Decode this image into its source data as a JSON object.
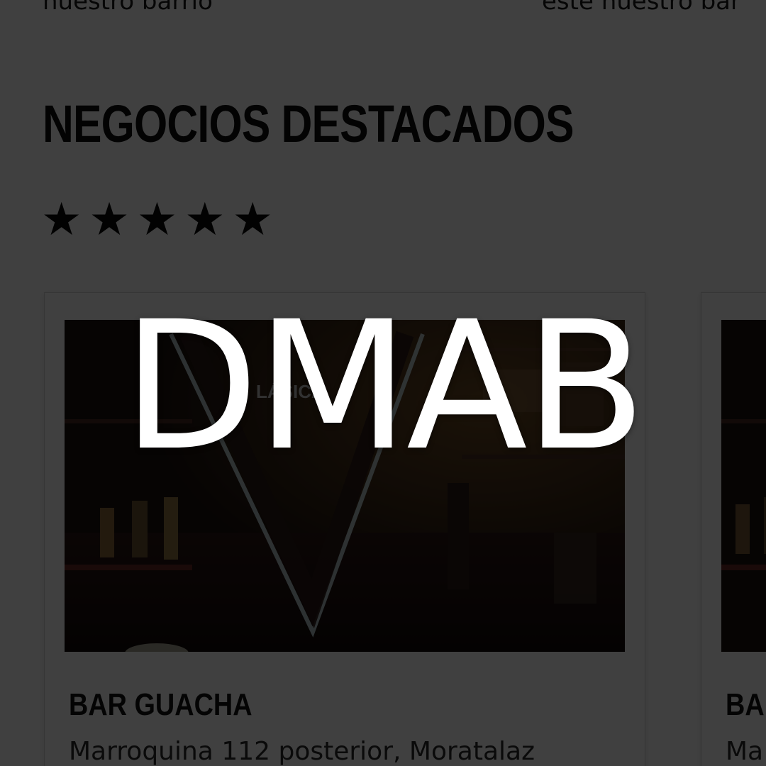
{
  "top_snippets": {
    "left": "nuestro barrio",
    "right": "este nuestro bar"
  },
  "section": {
    "title": "NEGOCIOS DESTACADOS",
    "rating_stars": 5,
    "rating_max": 5
  },
  "cards": [
    {
      "photo_sign_text": "LÁSICA",
      "name": "BAR GUACHA",
      "address": "Marroquina 112 posterior, Moratalaz"
    },
    {
      "name": "BA",
      "address": "Ma"
    }
  ],
  "overlay": {
    "brand": "DMAB",
    "dim_color": "#000000"
  },
  "icons": {
    "star": "star-icon"
  }
}
